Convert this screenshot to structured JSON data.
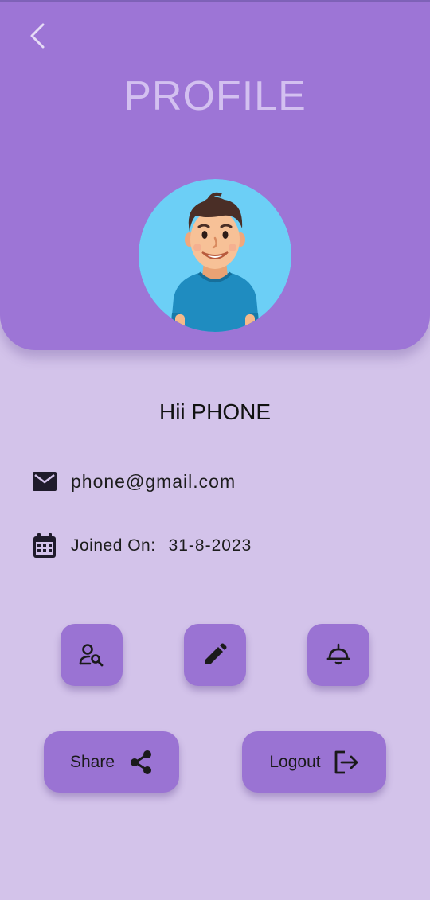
{
  "header": {
    "title": "PROFILE",
    "back_icon": "chevron-left-icon"
  },
  "profile": {
    "greeting": "Hii PHONE",
    "avatar": "cartoon-man-avatar",
    "email": "phone@gmail.com",
    "email_icon": "mail-icon",
    "joined_label": "Joined On:",
    "joined_date": "31-8-2023",
    "joined_icon": "calendar-icon"
  },
  "actions": {
    "icon_buttons": [
      {
        "icon": "person-search-icon"
      },
      {
        "icon": "edit-pencil-icon"
      },
      {
        "icon": "bell-icon"
      }
    ],
    "share": {
      "label": "Share",
      "icon": "share-icon"
    },
    "logout": {
      "label": "Logout",
      "icon": "logout-icon"
    }
  },
  "colors": {
    "background": "#d3c3ea",
    "header": "#9d75d6",
    "title": "#d3c0f0",
    "button": "#9a73d3",
    "avatar_background": "#6ccff6"
  }
}
